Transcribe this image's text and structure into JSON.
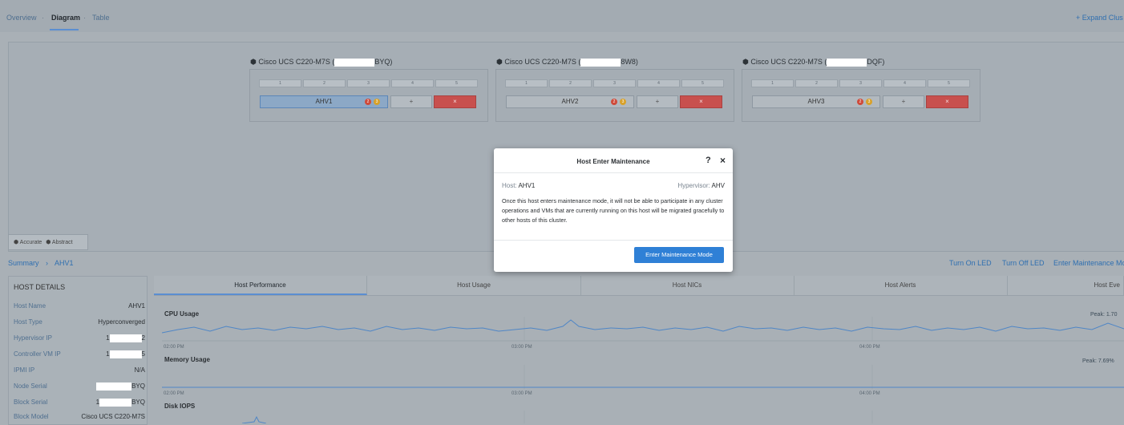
{
  "nav": {
    "tabs": [
      {
        "label": "Overview"
      },
      {
        "label": "Diagram"
      },
      {
        "label": "Table"
      }
    ],
    "separator": "·",
    "expand_label": "+ Expand Clus"
  },
  "diagram": {
    "blocks": [
      {
        "title_prefix": "Cisco UCS C220-M7S (",
        "title_suffix": "BYQ)",
        "host": "AHV1",
        "badge_red": "2",
        "badge_orange": "3",
        "selected": true
      },
      {
        "title_prefix": "Cisco UCS C220-M7S (",
        "title_suffix": "8W8)",
        "host": "AHV2",
        "badge_red": "2",
        "badge_orange": "3",
        "selected": false
      },
      {
        "title_prefix": "Cisco UCS C220-M7S (",
        "title_suffix": "DQF)",
        "host": "AHV3",
        "badge_red": "2",
        "badge_orange": "3",
        "selected": false
      }
    ],
    "slots": [
      "1",
      "2",
      "3",
      "4",
      "5"
    ],
    "plus_label": "+",
    "remove_label": "×",
    "toggle": {
      "accurate": "Accurate",
      "abstract": "Abstract"
    }
  },
  "breadcrumb": {
    "root": "Summary",
    "sep": "›",
    "current": "AHV1"
  },
  "actions": {
    "turn_on_led": "Turn On LED",
    "turn_off_led": "Turn Off LED",
    "enter_maint": "Enter Maintenance Mo"
  },
  "host_details": {
    "title": "HOST DETAILS",
    "rows": [
      {
        "key": "Host Name",
        "value": "AHV1"
      },
      {
        "key": "Host Type",
        "value": "Hyperconverged"
      },
      {
        "key": "Hypervisor IP",
        "value_prefix": "1",
        "value_suffix": "2"
      },
      {
        "key": "Controller VM IP",
        "value_prefix": "1",
        "value_suffix": "5"
      },
      {
        "key": "IPMI IP",
        "value": "N/A"
      },
      {
        "key": "Node Serial",
        "value_prefix": "",
        "value_suffix": "BYQ"
      },
      {
        "key": "Block Serial",
        "value_prefix": "1",
        "value_suffix": "BYQ"
      },
      {
        "key": "Block Model",
        "value": "Cisco UCS C220-M7S"
      }
    ]
  },
  "perf_tabs": [
    {
      "label": "Host Performance"
    },
    {
      "label": "Host Usage"
    },
    {
      "label": "Host NICs"
    },
    {
      "label": "Host Alerts"
    },
    {
      "label": "Host Eve"
    }
  ],
  "charts": {
    "cpu": {
      "label": "CPU Usage",
      "peak": "Peak: 1.70"
    },
    "memory": {
      "label": "Memory Usage",
      "peak": "Peak: 7.69%"
    },
    "disk": {
      "label": "Disk IOPS"
    },
    "time_ticks": [
      "02:00 PM",
      "03:00 PM",
      "04:00 PM"
    ]
  },
  "dialog": {
    "title": "Host Enter Maintenance",
    "help": "?",
    "close": "×",
    "host_label": "Host:",
    "host_value": "AHV1",
    "hypervisor_label": "Hypervisor:",
    "hypervisor_value": "AHV",
    "message": "Once this host enters maintenance mode, it will not be able to participate in any cluster operations and VMs that are currently running on this host will be migrated gracefully to other hosts of this cluster.",
    "button": "Enter Maintenance Mode"
  },
  "colors": {
    "accent": "#2f80d6",
    "danger": "#c8504e",
    "link": "#2f6fb0"
  }
}
